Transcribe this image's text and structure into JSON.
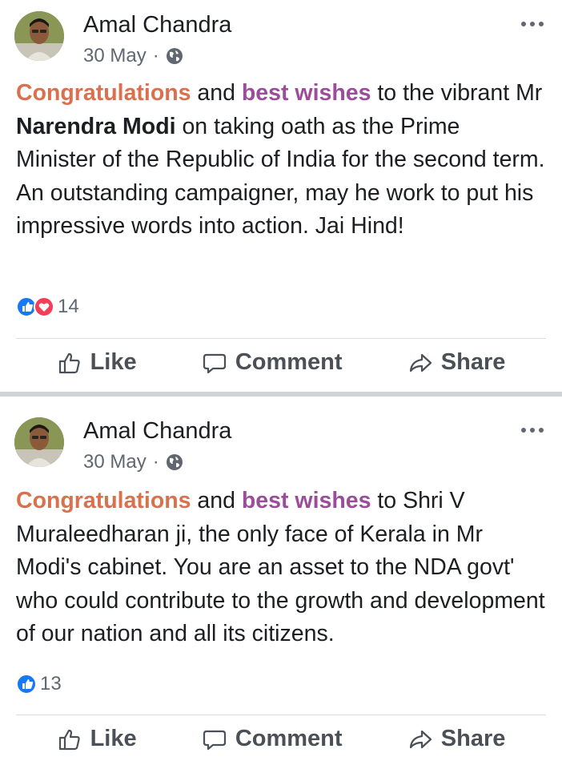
{
  "posts": [
    {
      "author": "Amal Chandra",
      "date": "30 May",
      "separator": "·",
      "privacy_icon": "globe-icon",
      "menu_icon": "more-options-icon",
      "text": {
        "w1": "Congratulations",
        "w2": " and ",
        "w3": "best wishes",
        "w4": " to the vibrant Mr ",
        "w5": "Narendra Modi",
        "w6": " on taking oath as the Prime Minister of the Republic of India for the second term. An outstanding campaigner, may he work to put his impressive words into action. Jai Hind!"
      },
      "reactions": [
        "like-reaction-icon",
        "love-reaction-icon"
      ],
      "reaction_count": "14",
      "actions": {
        "like": "Like",
        "comment": "Comment",
        "share": "Share"
      }
    },
    {
      "author": "Amal Chandra",
      "date": "30 May",
      "separator": "·",
      "privacy_icon": "globe-icon",
      "menu_icon": "more-options-icon",
      "text": {
        "w1": "Congratulations",
        "w2": " and ",
        "w3": "best wishes",
        "w4": " to Shri V Muraleedharan ji, the only face of Kerala in Mr Modi's cabinet. You are an asset to the NDA govt' who could contribute to the growth and development of our nation and all its citizens."
      },
      "reactions": [
        "like-reaction-icon"
      ],
      "reaction_count": "13",
      "actions": {
        "like": "Like",
        "comment": "Comment",
        "share": "Share"
      }
    }
  ],
  "colors": {
    "congratulations": "#d9714f",
    "best_wishes": "#9b4d9b",
    "like_blue": "#1877f2",
    "love_red": "#f33e58",
    "divider": "#d0d3d8"
  }
}
